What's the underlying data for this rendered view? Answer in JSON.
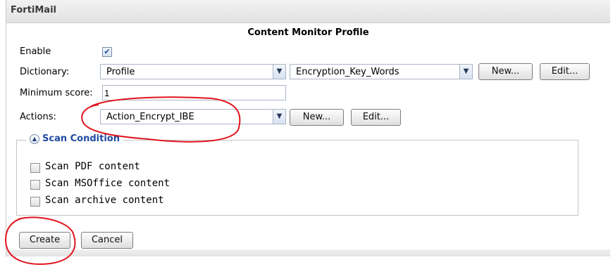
{
  "app": {
    "title": "FortiMail"
  },
  "dialog": {
    "title": "Content Monitor Profile"
  },
  "form": {
    "enable": {
      "label": "Enable",
      "checked": true
    },
    "dictionary": {
      "label": "Dictionary:",
      "type_value": "Profile",
      "profile_value": "Encryption_Key_Words",
      "new_label": "New...",
      "edit_label": "Edit..."
    },
    "minimum_score": {
      "label": "Minimum score:",
      "value": "1"
    },
    "actions": {
      "label": "Actions:",
      "value": "Action_Encrypt_IBE",
      "new_label": "New...",
      "edit_label": "Edit..."
    },
    "scan_condition": {
      "title": "Scan Condition",
      "options": [
        {
          "label": "Scan PDF content",
          "checked": false
        },
        {
          "label": "Scan MSOffice content",
          "checked": false
        },
        {
          "label": "Scan archive content",
          "checked": false
        }
      ]
    }
  },
  "footer": {
    "create_label": "Create",
    "cancel_label": "Cancel"
  },
  "annotation": {
    "color": "#e1141e"
  }
}
